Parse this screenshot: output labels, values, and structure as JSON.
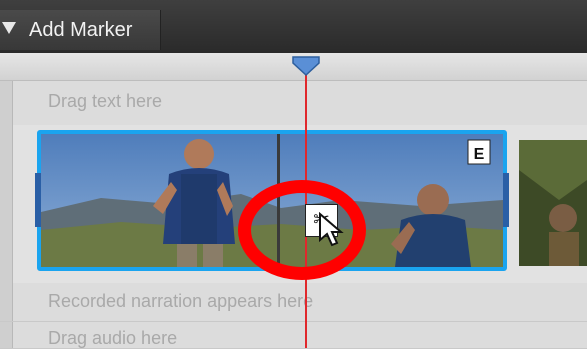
{
  "toolbar": {
    "add_marker_label": "Add Marker"
  },
  "timeline": {
    "text_track_hint": "Drag text here",
    "narration_track_hint": "Recorded narration appears here",
    "audio_track_hint": "Drag audio here"
  },
  "clip": {
    "badge": "E"
  },
  "colors": {
    "clip_selection_border": "#1aa4ef",
    "playhead": "#e0282c",
    "annotation_circle": "#ff0000"
  },
  "icons": [
    "dropdown-caret-icon",
    "playhead-marker-icon",
    "scissors-icon",
    "mouse-pointer-icon"
  ]
}
